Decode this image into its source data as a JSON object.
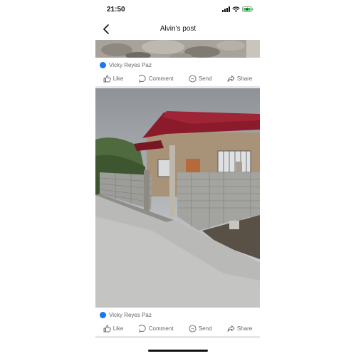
{
  "status_bar": {
    "time": "21:50"
  },
  "nav": {
    "title": "Alvin's post"
  },
  "posts": [
    {
      "author": "Vicky Reyes Paz"
    },
    {
      "author": "Vicky Reyes Paz"
    }
  ],
  "actions": {
    "like": "Like",
    "comment": "Comment",
    "send": "Send",
    "share": "Share"
  },
  "icons": [
    "chevron-left-icon",
    "signal-icon",
    "wifi-icon",
    "battery-charging-icon",
    "verified-icon",
    "like-icon",
    "comment-icon",
    "messenger-icon",
    "share-icon"
  ],
  "colors": {
    "accent": "#1877f2",
    "muted_text": "#65676b",
    "roof": "#8b1a2b"
  }
}
